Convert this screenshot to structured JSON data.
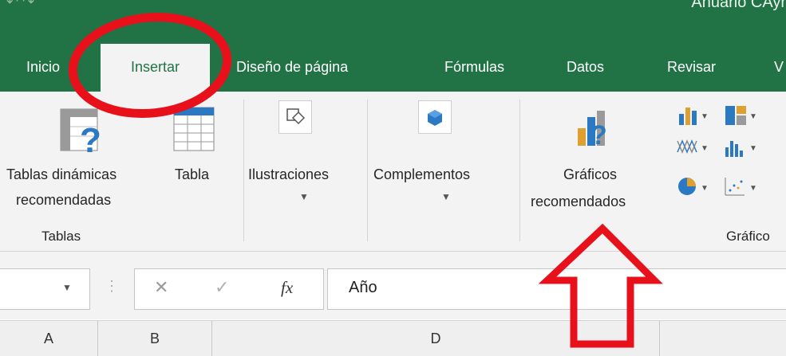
{
  "window": {
    "filename": "Anuario CAyr",
    "quick_access": "↶ ↷"
  },
  "tabs": [
    {
      "label": "Inicio"
    },
    {
      "label": "Insertar"
    },
    {
      "label": "Diseño de página"
    },
    {
      "label": "Fórmulas"
    },
    {
      "label": "Datos"
    },
    {
      "label": "Revisar"
    },
    {
      "label": "V"
    }
  ],
  "ribbon": {
    "tablas_dinamicas_line1": "Tablas dinámicas",
    "tablas_dinamicas_line2": "recomendadas",
    "tabla": "Tabla",
    "group_tablas": "Tablas",
    "ilustraciones": "Ilustraciones",
    "complementos": "Complementos",
    "graficos_line1": "Gráficos",
    "graficos_line2": "recomendados",
    "group_graficos": "Gráfico"
  },
  "formula_bar": {
    "fx": "fx",
    "value": "Año"
  },
  "columns": [
    "A",
    "B",
    "D"
  ],
  "colors": {
    "excel_green": "#217346",
    "annotation_red": "#e8101a"
  }
}
